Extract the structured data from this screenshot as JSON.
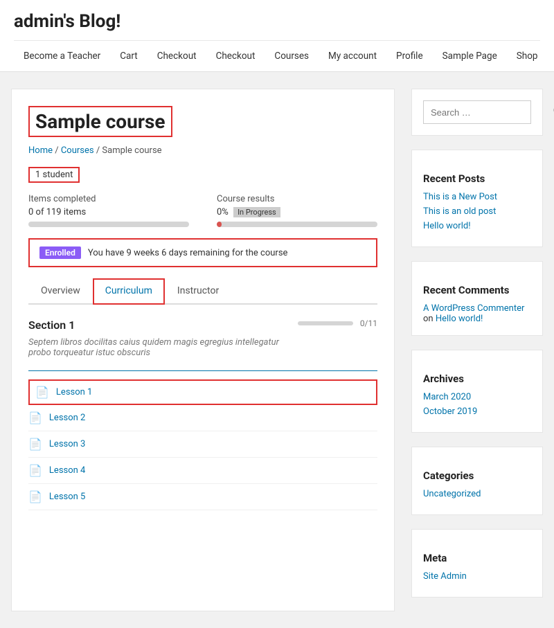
{
  "site": {
    "title": "admin's Blog!"
  },
  "nav": {
    "items": [
      {
        "label": "Become a Teacher",
        "id": "become-teacher"
      },
      {
        "label": "Cart",
        "id": "cart"
      },
      {
        "label": "Checkout",
        "id": "checkout-1"
      },
      {
        "label": "Checkout",
        "id": "checkout-2"
      },
      {
        "label": "Courses",
        "id": "courses"
      },
      {
        "label": "My account",
        "id": "my-account"
      },
      {
        "label": "Profile",
        "id": "profile"
      },
      {
        "label": "Sample Page",
        "id": "sample-page"
      },
      {
        "label": "Shop",
        "id": "shop"
      }
    ]
  },
  "course": {
    "title": "Sample course",
    "breadcrumb": {
      "home": "Home",
      "courses": "Courses",
      "current": "Sample course"
    },
    "student_count": "1 student",
    "items_completed_label": "Items completed",
    "items_completed_value": "0 of 119 items",
    "items_progress_pct": 0,
    "course_results_label": "Course results",
    "course_results_pct": "0%",
    "in_progress_label": "In Progress",
    "results_bar_pct": 3,
    "enrolled_tag": "Enrolled",
    "enrolled_message": "You have 9 weeks 6 days remaining for the course",
    "tabs": [
      {
        "label": "Overview",
        "id": "overview",
        "active": false
      },
      {
        "label": "Curriculum",
        "id": "curriculum",
        "active": true
      },
      {
        "label": "Instructor",
        "id": "instructor",
        "active": false
      }
    ],
    "section_title": "Section 1",
    "section_desc": "Septem libros docilitas caius quidem magis egregius intellegatur probo torqueatur istuc obscuris",
    "section_count": "0/11",
    "lessons": [
      {
        "label": "Lesson 1",
        "active": true
      },
      {
        "label": "Lesson 2",
        "active": false
      },
      {
        "label": "Lesson 3",
        "active": false
      },
      {
        "label": "Lesson 4",
        "active": false
      },
      {
        "label": "Lesson 5",
        "active": false
      }
    ]
  },
  "sidebar": {
    "search": {
      "placeholder": "Search …"
    },
    "recent_posts": {
      "title": "Recent Posts",
      "items": [
        {
          "label": "This is a New Post"
        },
        {
          "label": "This is an old post"
        },
        {
          "label": "Hello world!"
        }
      ]
    },
    "recent_comments": {
      "title": "Recent Comments",
      "commenter": "A WordPress Commenter",
      "on": "on",
      "post": "Hello world!"
    },
    "archives": {
      "title": "Archives",
      "items": [
        {
          "label": "March 2020"
        },
        {
          "label": "October 2019"
        }
      ]
    },
    "categories": {
      "title": "Categories",
      "items": [
        {
          "label": "Uncategorized"
        }
      ]
    },
    "meta": {
      "title": "Meta",
      "items": [
        {
          "label": "Site Admin"
        }
      ]
    }
  }
}
